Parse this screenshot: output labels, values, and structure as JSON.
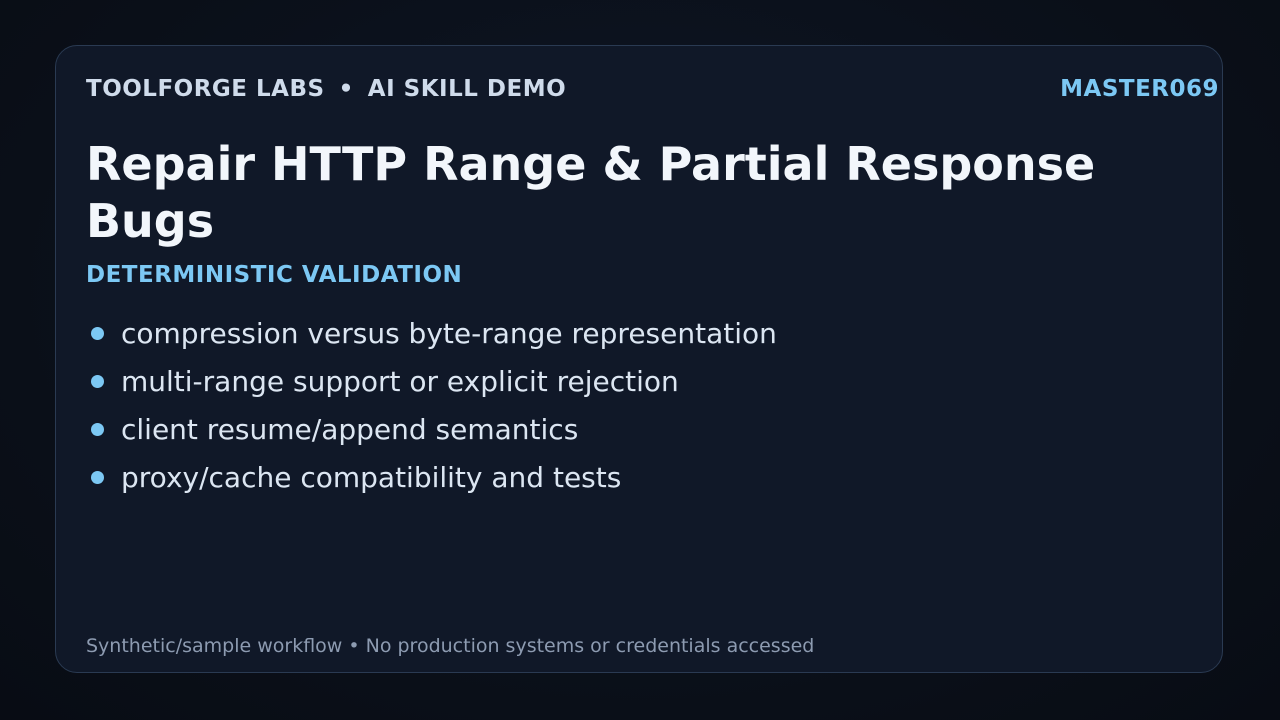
{
  "header": {
    "brand": "TOOLFORGE LABS",
    "separator": "•",
    "section": "AI SKILL DEMO",
    "code": "MASTER069"
  },
  "title": "Repair HTTP Range & Partial Response Bugs",
  "subtitle": "DETERMINISTIC VALIDATION",
  "bullets": [
    "compression versus byte-range representation",
    "multi-range support or explicit rejection",
    "client resume/append semantics",
    "proxy/cache compatibility and tests"
  ],
  "footer": "Synthetic/sample workflow • No production systems or credentials accessed",
  "colors": {
    "accent": "#7cc8f4",
    "background": "#0a0f18",
    "card": "#101828",
    "border": "#2a3a52"
  }
}
